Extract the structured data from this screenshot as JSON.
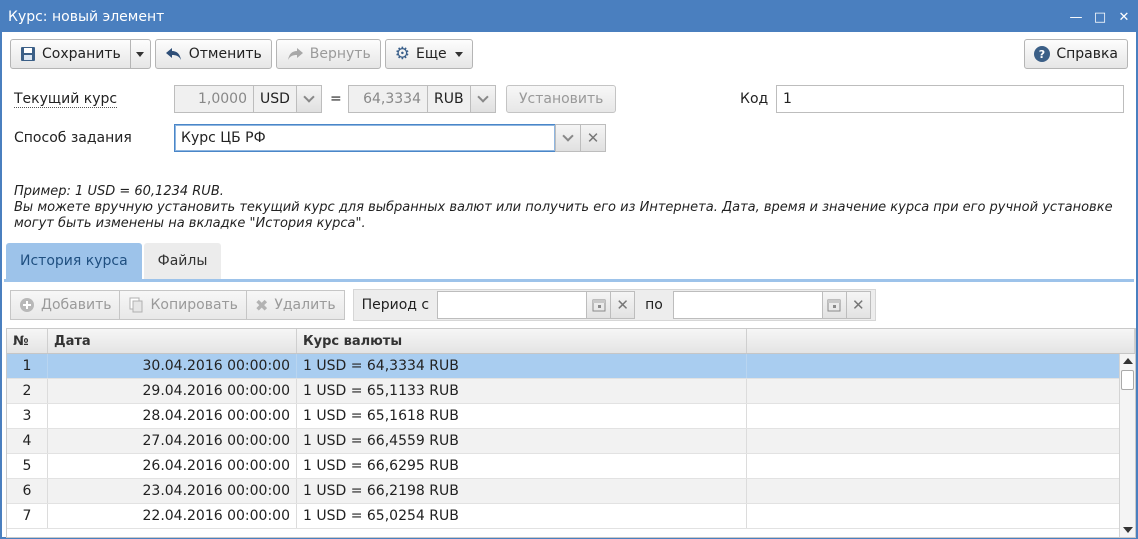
{
  "window": {
    "title": "Курс: новый элемент"
  },
  "toolbar": {
    "save": "Сохранить",
    "cancel": "Отменить",
    "redo": "Вернуть",
    "more": "Еще",
    "help": "Справка"
  },
  "form": {
    "current_rate_label": "Текущий курс",
    "amount": "1,0000",
    "currency_from": "USD",
    "equals": "=",
    "rate": "64,3334",
    "currency_to": "RUB",
    "set_button": "Установить",
    "code_label": "Код",
    "code_value": "1",
    "method_label": "Способ задания",
    "method_value": "Курс ЦБ РФ"
  },
  "note": {
    "line1": "Пример: 1 USD = 60,1234 RUB.",
    "line2": "Вы можете вручную установить текущий курс для выбранных валют или получить его из Интернета. Дата, время и значение курса при его ручной установке могут быть изменены на вкладке \"История курса\"."
  },
  "tabs": [
    {
      "label": "История курса",
      "active": true
    },
    {
      "label": "Файлы",
      "active": false
    }
  ],
  "table_toolbar": {
    "add": "Добавить",
    "copy": "Копировать",
    "delete": "Удалить",
    "period_from": "Период с",
    "period_to": "по"
  },
  "table": {
    "columns": [
      "№",
      "Дата",
      "Курс валюты",
      ""
    ],
    "rows": [
      {
        "n": "1",
        "date": "30.04.2016 00:00:00",
        "rate": "1 USD = 64,3334 RUB"
      },
      {
        "n": "2",
        "date": "29.04.2016 00:00:00",
        "rate": "1 USD = 65,1133 RUB"
      },
      {
        "n": "3",
        "date": "28.04.2016 00:00:00",
        "rate": "1 USD = 65,1618 RUB"
      },
      {
        "n": "4",
        "date": "27.04.2016 00:00:00",
        "rate": "1 USD = 66,4559 RUB"
      },
      {
        "n": "5",
        "date": "26.04.2016 00:00:00",
        "rate": "1 USD = 66,6295 RUB"
      },
      {
        "n": "6",
        "date": "23.04.2016 00:00:00",
        "rate": "1 USD = 66,2198 RUB"
      },
      {
        "n": "7",
        "date": "22.04.2016 00:00:00",
        "rate": "1 USD = 65,0254 RUB"
      }
    ]
  },
  "colors": {
    "accent": "#4a7fbf",
    "tab_active": "#9dc3ea",
    "row_selected": "#a9cdf0"
  }
}
